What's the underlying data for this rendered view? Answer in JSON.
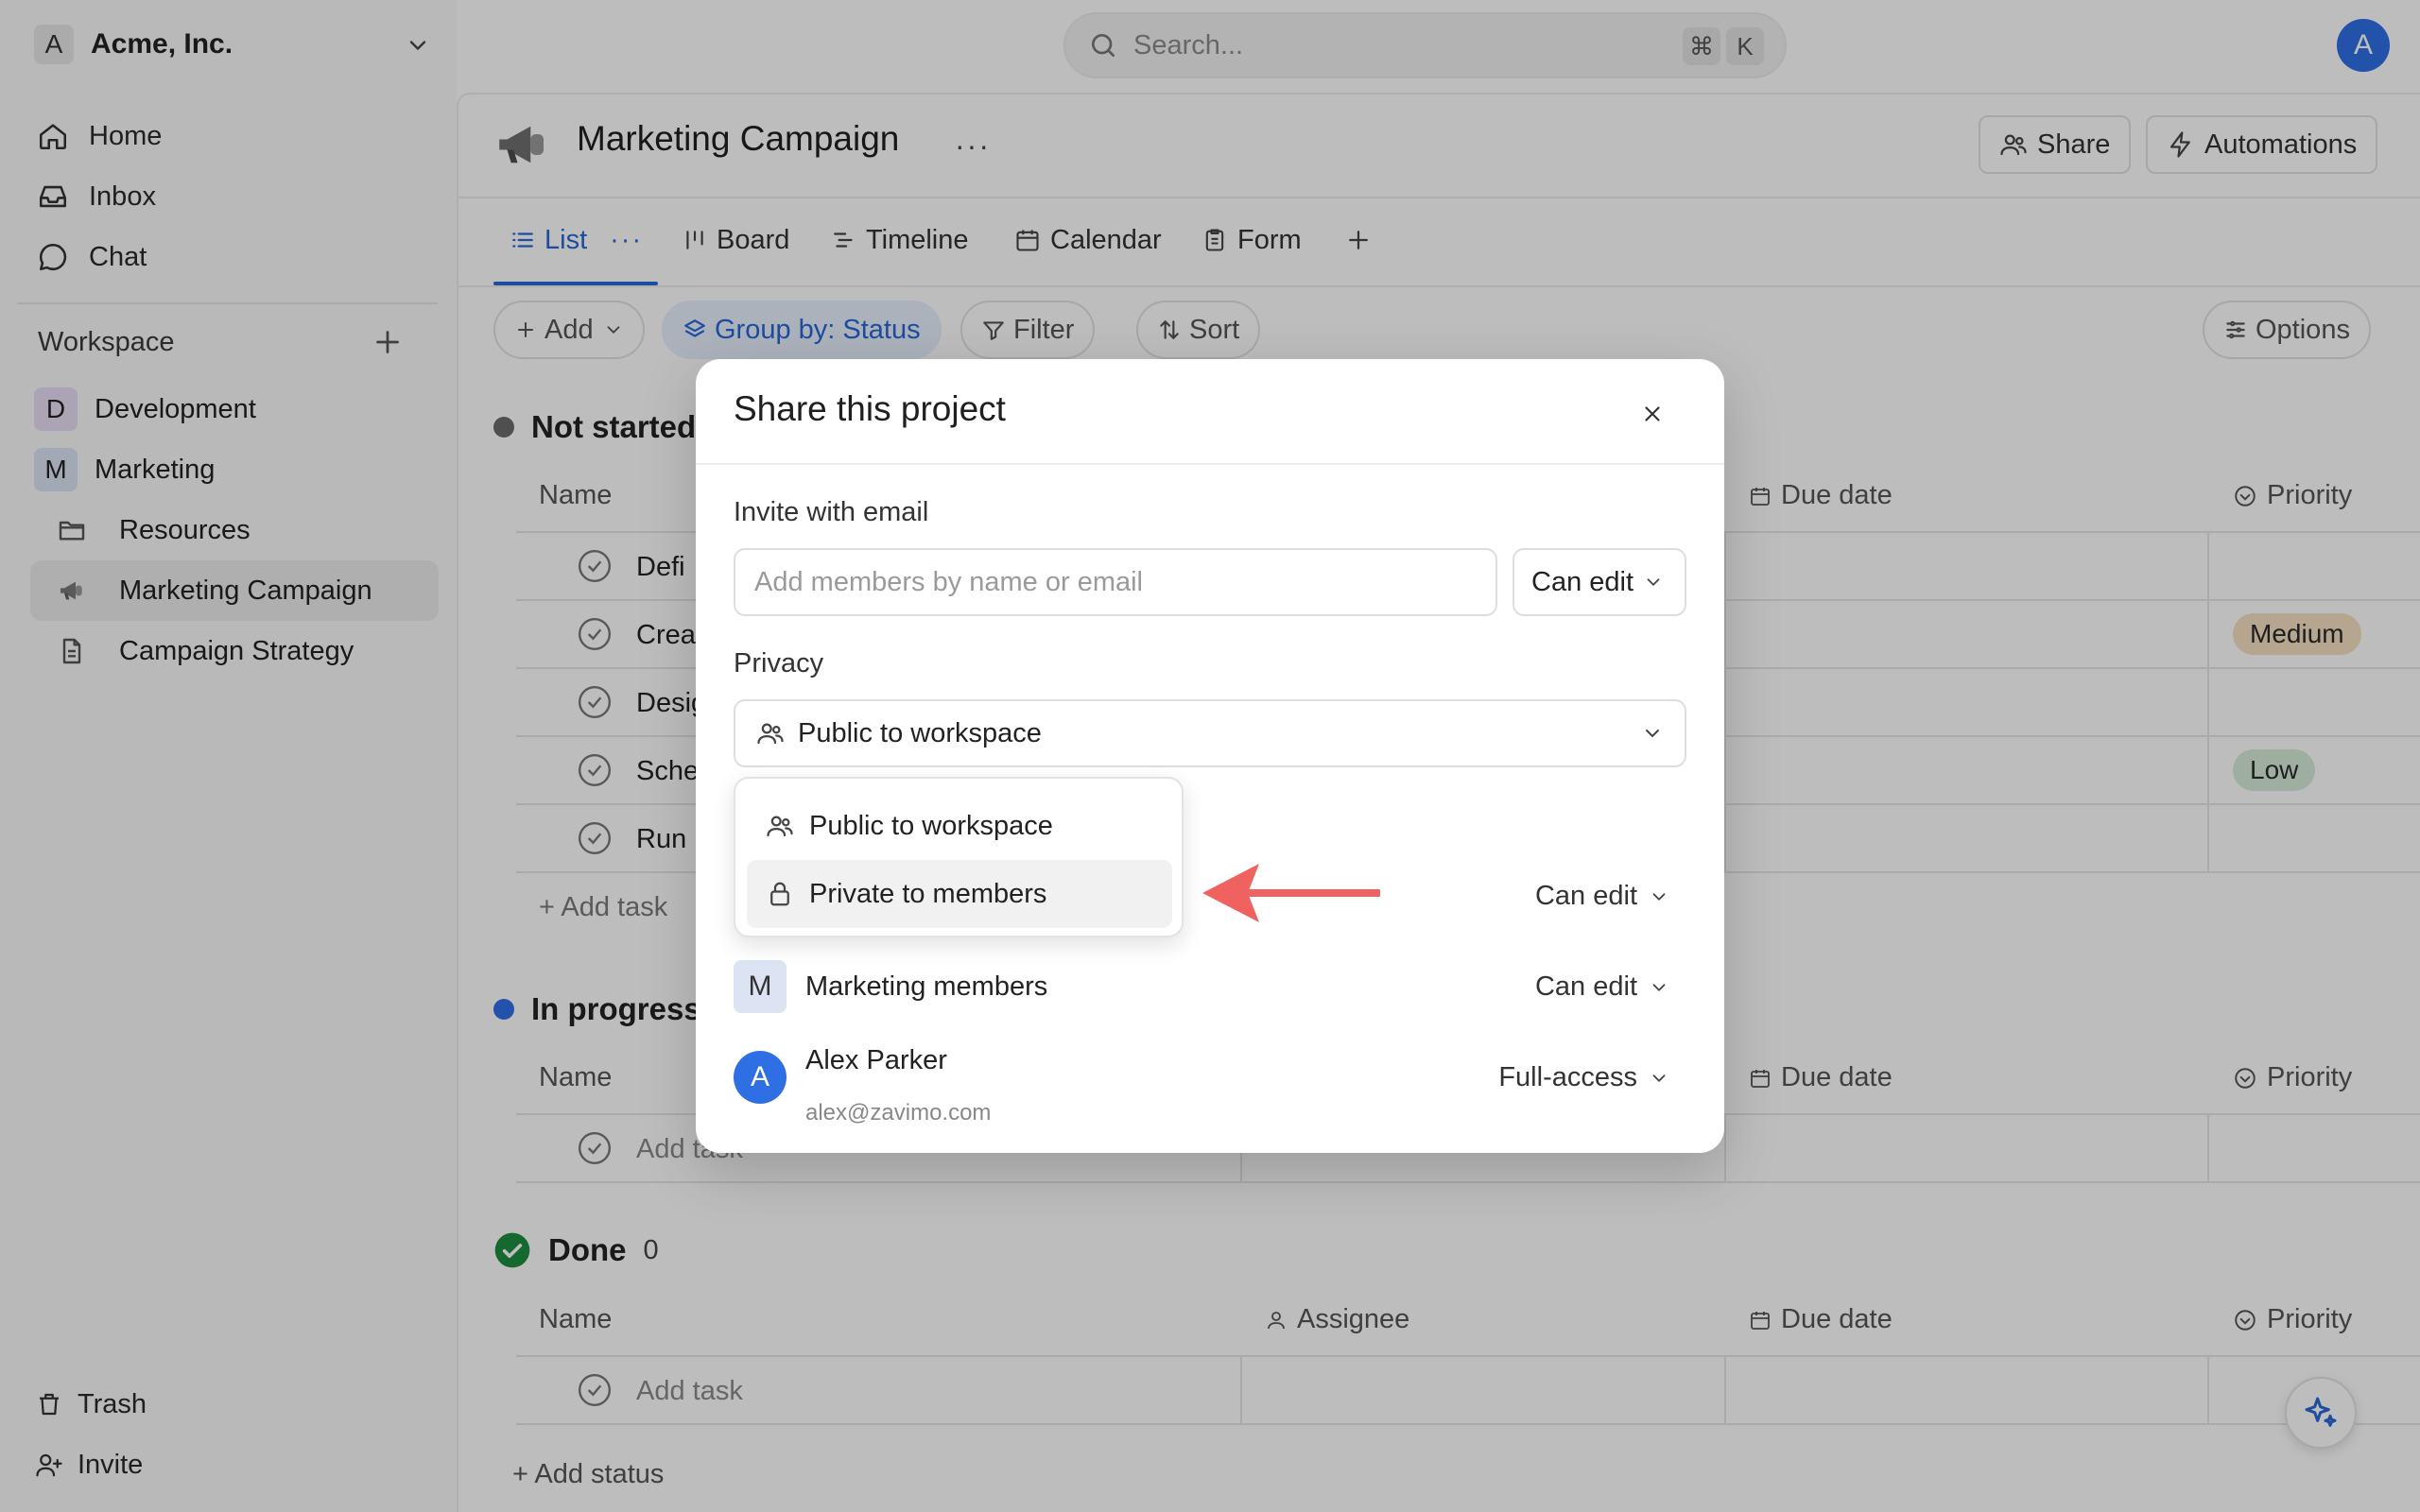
{
  "workspace": {
    "avatar": "A",
    "name": "Acme, Inc."
  },
  "nav": [
    {
      "label": "Home",
      "icon": "home-icon"
    },
    {
      "label": "Inbox",
      "icon": "inbox-icon"
    },
    {
      "label": "Chat",
      "icon": "chat-icon"
    }
  ],
  "sidebar": {
    "section_label": "Workspace",
    "teams": [
      {
        "badge": "D",
        "label": "Development",
        "color": "#e7def3"
      },
      {
        "badge": "M",
        "label": "Marketing",
        "color": "#dce4f3"
      }
    ],
    "pages": [
      {
        "label": "Resources",
        "icon": "folder-icon"
      },
      {
        "label": "Marketing Campaign",
        "icon": "megaphone-icon",
        "active": true
      },
      {
        "label": "Campaign Strategy",
        "icon": "document-icon"
      }
    ],
    "bottom": [
      {
        "label": "Trash",
        "icon": "trash-icon"
      },
      {
        "label": "Invite",
        "icon": "invite-user-icon"
      }
    ]
  },
  "search": {
    "placeholder": "Search...",
    "shortcut_mod": "⌘",
    "shortcut_key": "K"
  },
  "user": {
    "avatar": "A"
  },
  "project": {
    "title": "Marketing Campaign",
    "more": "···",
    "share_label": "Share",
    "automations_label": "Automations"
  },
  "tabs": [
    {
      "label": "List",
      "active": true
    },
    {
      "label": "Board"
    },
    {
      "label": "Timeline"
    },
    {
      "label": "Calendar"
    },
    {
      "label": "Form"
    }
  ],
  "tab_more": "···",
  "toolbar": {
    "add": "Add",
    "group_by": "Group by: Status",
    "filter": "Filter",
    "sort": "Sort",
    "options": "Options"
  },
  "columns": {
    "name": "Name",
    "assignee": "Assignee",
    "due_date": "Due date",
    "priority": "Priority"
  },
  "groups": {
    "not_started": {
      "label": "Not started",
      "tasks": [
        {
          "name": "Defi"
        },
        {
          "name": "Crea",
          "priority": "Medium"
        },
        {
          "name": "Desig"
        },
        {
          "name": "Sche",
          "priority": "Low"
        },
        {
          "name": "Run p"
        }
      ],
      "add_task": "+ Add task"
    },
    "in_progress": {
      "label": "In progress",
      "add_task": "Add task"
    },
    "done": {
      "label": "Done",
      "count": "0",
      "add_task": "Add task"
    }
  },
  "add_status": "+ Add status",
  "colors": {
    "accent": "#2867d8",
    "not_started_dot": "#6b6b6b",
    "in_progress_dot": "#2f6fe4",
    "done_dot": "#1e8e3e",
    "medium_badge": "#f6dfc2",
    "low_badge": "#d5ecd9",
    "arrow": "#f0625f"
  },
  "modal": {
    "title": "Share this project",
    "invite_label": "Invite with email",
    "invite_placeholder": "Add members by name or email",
    "invite_permission": "Can edit",
    "privacy_label": "Privacy",
    "privacy_value": "Public to workspace",
    "privacy_options": [
      "Public to workspace",
      "Private to members"
    ],
    "members": [
      {
        "avatar": "",
        "name": "",
        "permission": "Can edit"
      },
      {
        "avatar": "M",
        "name": "Marketing members",
        "permission": "Can edit"
      },
      {
        "avatar": "A",
        "name": "Alex Parker",
        "email": "alex@zavimo.com",
        "permission": "Full-access"
      }
    ]
  }
}
